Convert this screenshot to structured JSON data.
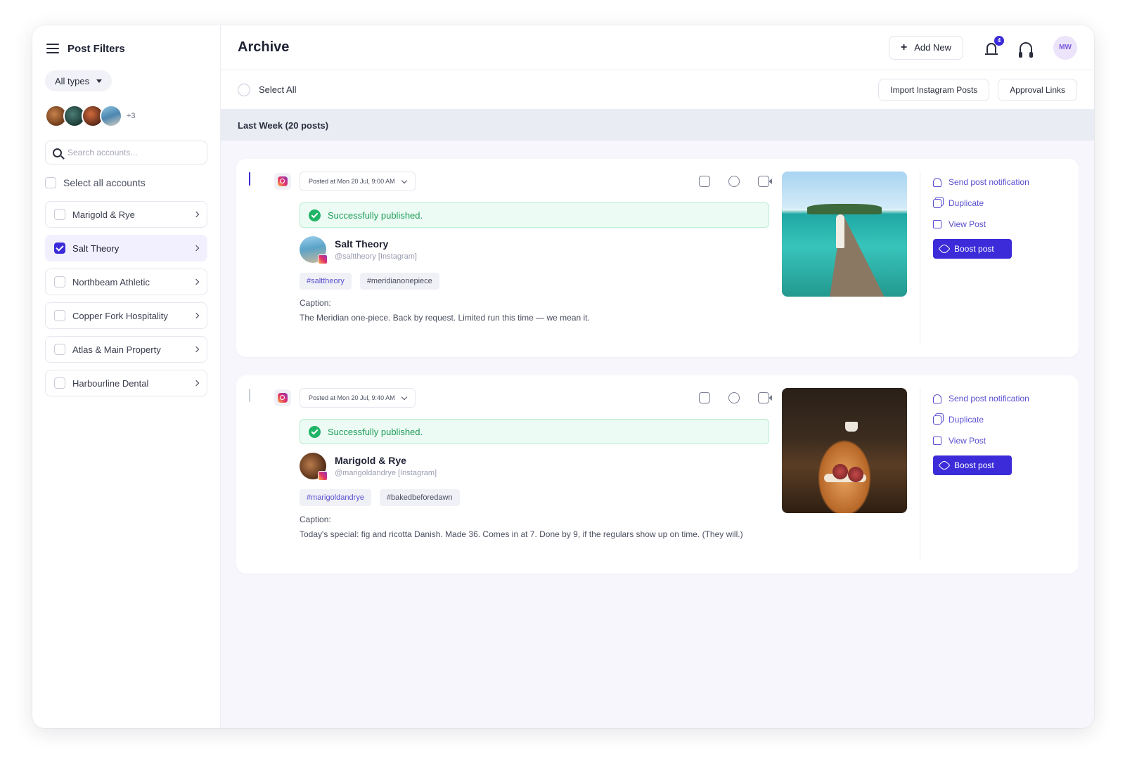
{
  "sidebar": {
    "title": "Post Filters",
    "type_filter": "All types",
    "avatars_more": "+3",
    "search_placeholder": "Search accounts...",
    "select_all_label": "Select all accounts",
    "accounts": [
      {
        "label": "Marigold & Rye",
        "checked": false
      },
      {
        "label": "Salt Theory",
        "checked": true
      },
      {
        "label": "Northbeam Athletic",
        "checked": false
      },
      {
        "label": "Copper Fork Hospitality",
        "checked": false
      },
      {
        "label": "Atlas & Main Property",
        "checked": false
      },
      {
        "label": "Harbourline Dental",
        "checked": false
      }
    ]
  },
  "header": {
    "title": "Archive",
    "add_new_label": "Add New",
    "notification_count": "4",
    "user_initials": "MW"
  },
  "toolbar": {
    "select_all_label": "Select All",
    "import_label": "Import Instagram Posts",
    "approval_label": "Approval Links"
  },
  "group": {
    "label": "Last Week (20 posts)"
  },
  "posts": [
    {
      "checked": true,
      "posted_at": "Posted at Mon 20 Jul, 9:00 AM",
      "status": "Successfully published.",
      "author_name": "Salt Theory",
      "author_handle": "@salttheory [Instagram]",
      "tags": [
        "#salttheory",
        "#meridianonepiece"
      ],
      "caption_label": "Caption:",
      "caption": "The Meridian one-piece. Back by request. Limited run this time — we mean it.",
      "actions": {
        "notify": "Send post notification",
        "duplicate": "Duplicate",
        "view": "View Post",
        "boost": "Boost post"
      }
    },
    {
      "checked": false,
      "posted_at": "Posted at Mon 20 Jul, 9:40 AM",
      "status": "Successfully published.",
      "author_name": "Marigold & Rye",
      "author_handle": "@marigoldandrye [Instagram]",
      "tags": [
        "#marigoldandrye",
        "#bakedbeforedawn"
      ],
      "caption_label": "Caption:",
      "caption": "Today's special: fig and ricotta Danish. Made 36. Comes in at 7. Done by 9, if the regulars show up on time. (They will.)",
      "actions": {
        "notify": "Send post notification",
        "duplicate": "Duplicate",
        "view": "View Post",
        "boost": "Boost post"
      }
    }
  ],
  "colors": {
    "accent": "#3b2bd8",
    "success": "#1fb466",
    "link": "#5a4fd0"
  }
}
